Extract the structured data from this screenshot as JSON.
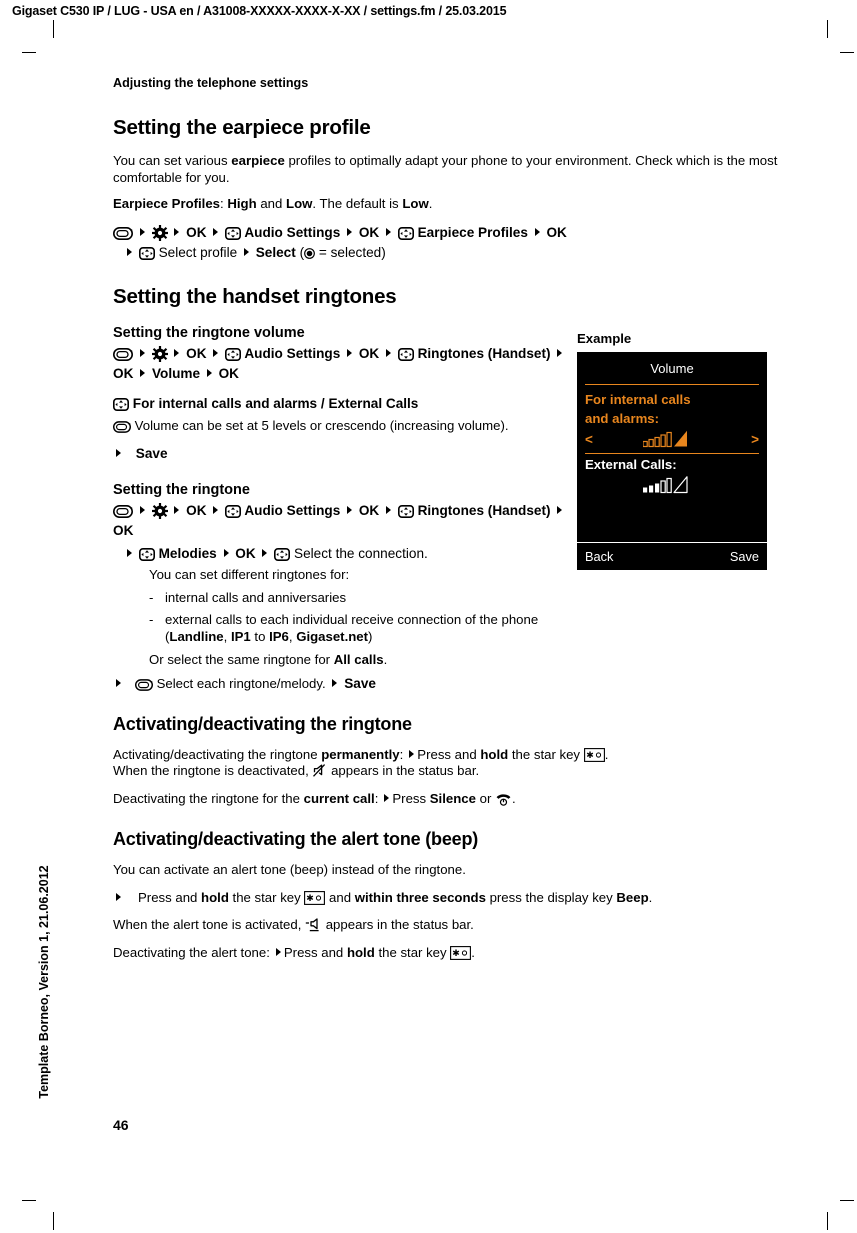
{
  "header": {
    "text": "Gigaset C530 IP / LUG - USA en / A31008-XXXXX-XXXX-X-XX / settings.fm / 25.03.2015"
  },
  "footer": {
    "template_note": "Template Borneo, Version 1, 21.06.2012",
    "page_number": "46"
  },
  "running_head": "Adjusting the telephone settings",
  "sections": {
    "earpiece": {
      "title": "Setting the earpiece profile",
      "intro_1": "You can set various ",
      "intro_bold": "earpiece",
      "intro_2": " profiles to optimally adapt your phone to your environment. Check which is the most comfortable for you.",
      "profiles_label": "Earpiece Profiles",
      "profiles_sep": ": ",
      "profiles_high": "High",
      "profiles_and": " and ",
      "profiles_low": "Low",
      "profiles_default_text": ". The default is ",
      "profiles_default": "Low",
      "profiles_end": ".",
      "nav": {
        "ok_1": "OK",
        "audio_settings": "Audio Settings",
        "ok_2": "OK",
        "earpiece_profiles": "Earpiece Profiles",
        "ok_3": "OK",
        "select_profile": "Select profile",
        "select": "Select",
        "selected_note_open": "(",
        "selected_note_close": " = selected)"
      }
    },
    "ringtones": {
      "title": "Setting the handset ringtones",
      "volume": {
        "subtitle": "Setting the ringtone volume",
        "nav": {
          "ok_1": "OK",
          "audio_settings": "Audio Settings",
          "ok_2": "OK",
          "ringtones_handset": "Ringtones (Handset)",
          "ok_3": "OK",
          "volume": "Volume",
          "ok_4": "OK"
        },
        "line_internal": "For internal calls and alarms / External Calls",
        "line_levels": "Volume can be set at 5 levels or crescendo (increasing volume).",
        "save": "Save"
      },
      "ringtone": {
        "subtitle": "Setting the ringtone",
        "nav": {
          "ok_1": "OK",
          "audio_settings": "Audio Settings",
          "ok_2": "OK",
          "ringtones_handset": "Ringtones (Handset)",
          "ok_3": "OK",
          "melodies": "Melodies",
          "ok_4": "OK",
          "select_connection": "Select the connection."
        },
        "can_set": "You can set different ringtones for:",
        "bullet_1": "internal calls and anniversaries",
        "bullet_2_a": "external calls to each individual receive connection of the phone (",
        "bullet_2_landline": "Landline",
        "bullet_2_to": ", ",
        "bullet_2_ip1": "IP1",
        "bullet_2_mid": " to ",
        "bullet_2_ip6": "IP6",
        "bullet_2_comma": ", ",
        "bullet_2_gigaset": "Gigaset.net",
        "bullet_2_b": ")",
        "or_select_a": "Or select the same ringtone for ",
        "or_select_bold": "All calls",
        "or_select_b": ".",
        "final_select": "Select each ringtone/melody.",
        "final_save": "Save"
      }
    },
    "activate_ringtone": {
      "title": "Activating/deactivating the ringtone",
      "line1_a": "Activating/deactivating the ringtone ",
      "line1_bold": "permanently",
      "line1_b": ":",
      "line1_press": "Press and ",
      "line1_hold": "hold",
      "line1_star": " the star key ",
      "line1_end": ".",
      "line2_a": "When the ringtone is deactivated, ",
      "line2_b": " appears in the status bar.",
      "line3_a": "Deactivating the ringtone for the ",
      "line3_bold": "current call",
      "line3_b": ":",
      "line3_press": "Press ",
      "line3_silence": "Silence",
      "line3_or": " or ",
      "line3_end": "."
    },
    "alert_tone": {
      "title": "Activating/deactivating the alert tone (beep)",
      "intro": "You can activate an alert tone (beep) instead of the ringtone.",
      "step_press": "Press and ",
      "step_hold": "hold",
      "step_star": " the star key ",
      "step_and": " and ",
      "step_within": "within three seconds",
      "step_display": " press the display key ",
      "step_beep": "Beep",
      "step_end": ".",
      "activated_a": "When the alert tone is activated, ",
      "activated_b": " appears in the status bar.",
      "deactivate_a": "Deactivating the alert tone:",
      "deactivate_press": "Press and ",
      "deactivate_hold": "hold",
      "deactivate_star": " the star key ",
      "deactivate_end": "."
    }
  },
  "example": {
    "label": "Example",
    "display": {
      "title": "Volume",
      "selected_line_1": "For internal calls",
      "selected_line_2": "and alarms:",
      "left_arrow": "<",
      "right_arrow": ">",
      "external_label": "External Calls:",
      "softkey_left": "Back",
      "softkey_right": "Save",
      "accent_color": "#E8861E",
      "background_color": "#000000",
      "internal_volume_bars_outline": 5,
      "internal_volume_crescendo": true,
      "external_volume_bars_filled": 3,
      "external_volume_bars_outline": 2,
      "external_volume_crescendo_outline": true
    }
  }
}
